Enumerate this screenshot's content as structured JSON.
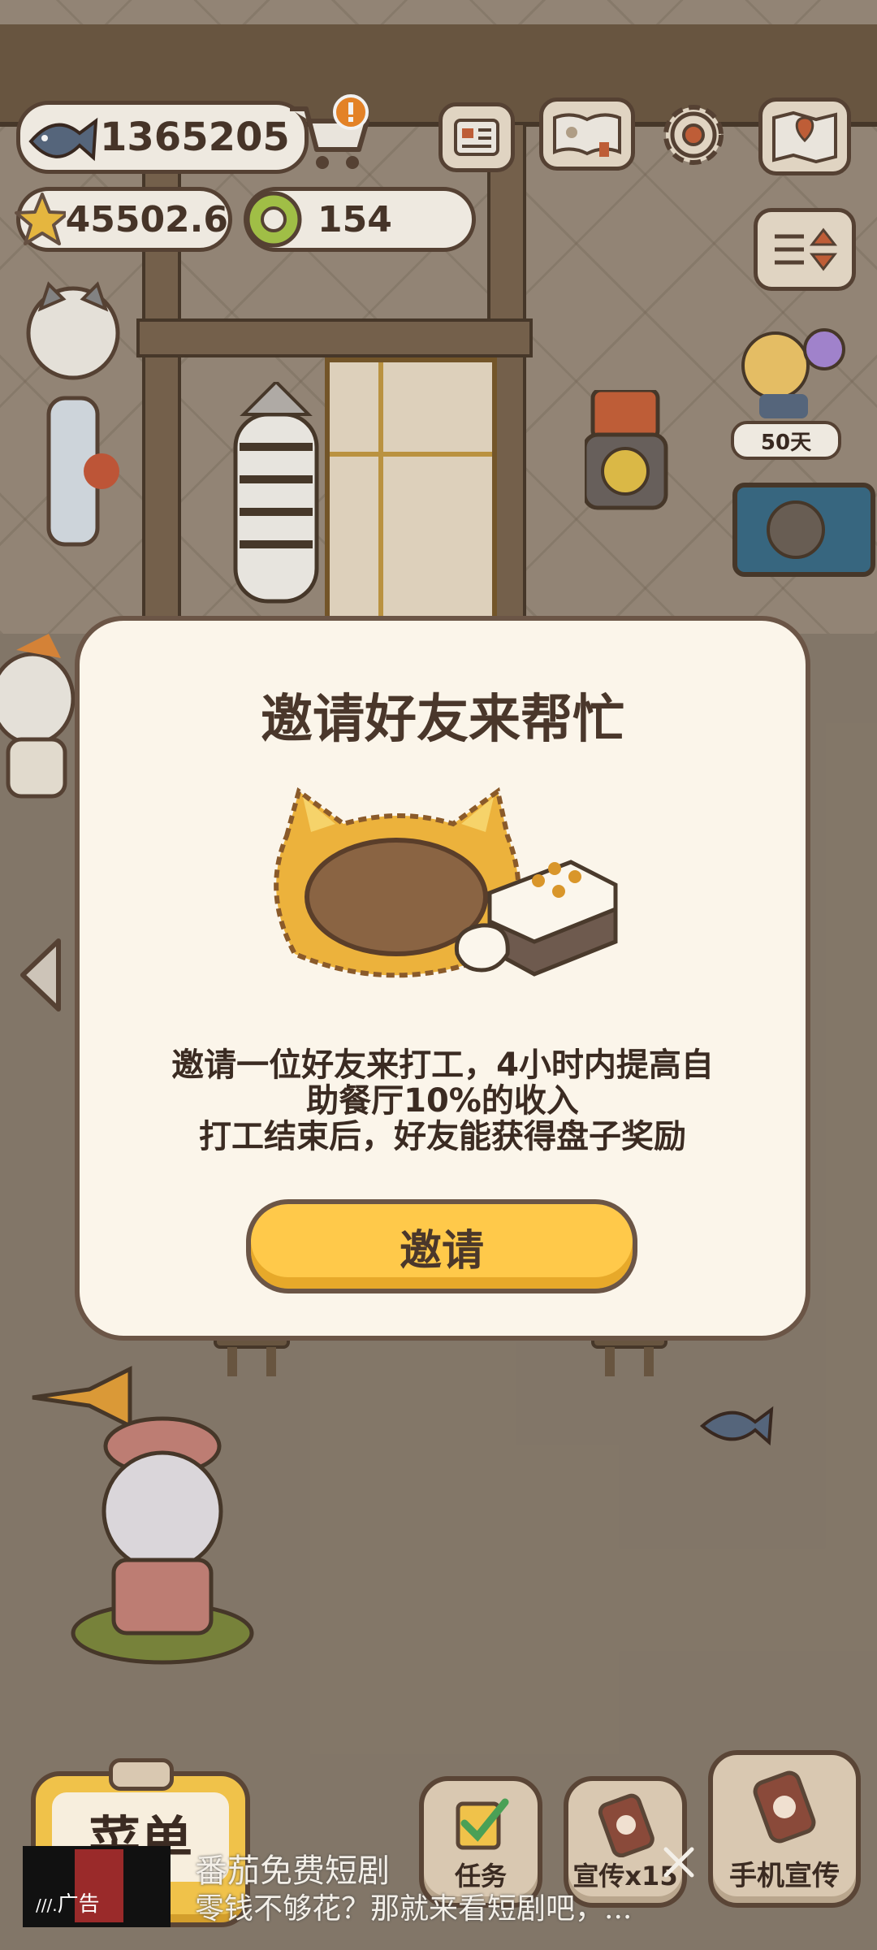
{
  "currency": {
    "fish": "1365205",
    "stars": "45502.6",
    "rings": "154"
  },
  "side": {
    "days_badge": "50天"
  },
  "modal": {
    "title": "邀请好友来帮忙",
    "desc_line1": "邀请一位好友来打工，4小时内提高自",
    "desc_line2": "助餐厅10%的收入",
    "desc_line3": "打工结束后，好友能获得盘子奖励",
    "invite_label": "邀请"
  },
  "bottom": {
    "menu_label": "菜单",
    "task_label": "任务",
    "promo_label": "宣传x15",
    "phone_promo_label": "手机宣传"
  },
  "ad": {
    "badge": "广告",
    "title": "番茄免费短剧",
    "text": "零钱不够花？那就来看短剧吧，..."
  },
  "colors": {
    "accent_yellow": "#ffc94a",
    "panel": "#fbf5ea",
    "border_brown": "#5a4536",
    "alert_orange": "#f0892a"
  }
}
